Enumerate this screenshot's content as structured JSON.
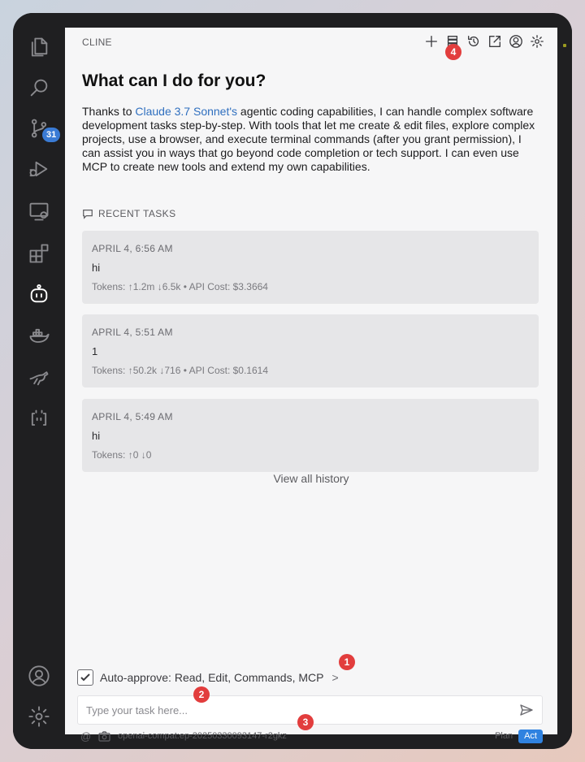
{
  "panel": {
    "title": "CLINE"
  },
  "header_icons": [
    "plus-icon",
    "mcp-servers-icon",
    "history-icon",
    "popout-icon",
    "account-icon",
    "settings-icon"
  ],
  "welcome": {
    "heading": "What can I do for you?",
    "intro_before": "Thanks to ",
    "intro_link": "Claude 3.7 Sonnet's",
    "intro_after": " agentic coding capabilities, I can handle complex software development tasks step-by-step. With tools that let me create & edit files, explore complex projects, use a browser, and execute terminal commands (after you grant permission), I can assist you in ways that go beyond code completion or tech support. I can even use MCP to create new tools and extend my own capabilities."
  },
  "recent": {
    "title": "RECENT TASKS",
    "tasks": [
      {
        "date": "APRIL 4, 6:56 AM",
        "text": "hi",
        "meta": "Tokens: ↑1.2m ↓6.5k • API Cost: $3.3664"
      },
      {
        "date": "APRIL 4, 5:51 AM",
        "text": "1",
        "meta": "Tokens: ↑50.2k ↓716 • API Cost: $0.1614"
      },
      {
        "date": "APRIL 4, 5:49 AM",
        "text": "hi",
        "meta": "Tokens: ↑0 ↓0"
      }
    ],
    "view_all": "View all history"
  },
  "auto_approve": {
    "label": "Auto-approve: Read, Edit, Commands, MCP",
    "checked": true,
    "chevron": ">"
  },
  "input": {
    "placeholder": "Type your task here...",
    "value": ""
  },
  "footer": {
    "at": "@",
    "model": "openai-compat:ep-20250330093147-r2gkz",
    "plan": "Plan",
    "act": "Act",
    "active_mode": "Act"
  },
  "activity_bar": {
    "items": [
      "explorer-icon",
      "search-icon",
      "source-control-icon",
      "run-debug-icon",
      "remote-explorer-icon",
      "extensions-icon",
      "cline-icon",
      "docker-icon",
      "kangaroo-icon",
      "copilot-icon"
    ],
    "bottom": [
      "accounts-icon",
      "manage-icon"
    ],
    "scm_badge": "31"
  },
  "markers": {
    "m1": "1",
    "m2": "2",
    "m3": "3",
    "m4": "4"
  },
  "colors": {
    "accent": "#2f82e0",
    "link": "#2f6fbf",
    "marker": "#e23d3d",
    "badge": "#3a7bd5"
  }
}
